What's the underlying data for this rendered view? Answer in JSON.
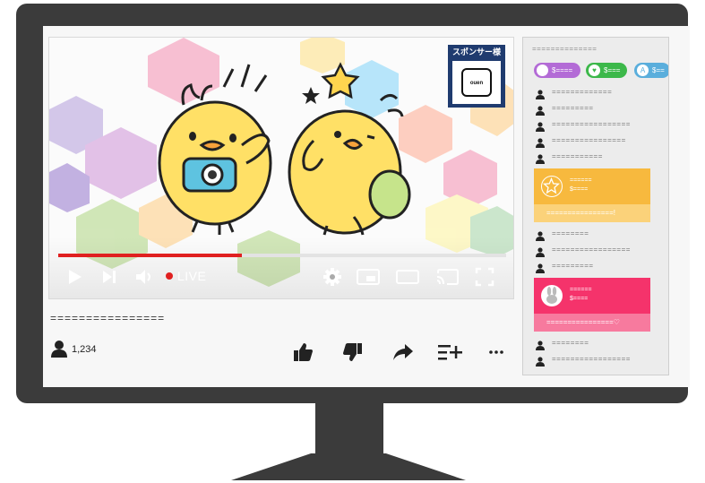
{
  "video": {
    "sponsor_label": "スポンサー様",
    "sponsor_logo": "ouen",
    "live_label": "LIVE",
    "progress": 0.41
  },
  "stream": {
    "title": "================",
    "viewer_count": "1,234"
  },
  "chat": {
    "header": "==============",
    "badges": [
      {
        "label": "$====",
        "color": "#b36bd6",
        "icon": "smile-icon"
      },
      {
        "label": "$===",
        "color": "#3cb84a",
        "icon": "heart-icon"
      },
      {
        "label": "$==",
        "color": "#5aaedc",
        "icon": "a-icon"
      }
    ],
    "messages_top": [
      "=============",
      "=========",
      "=================",
      "================",
      "==========="
    ],
    "superchat_1": {
      "name": "======",
      "amount": "$====",
      "text": "================!",
      "color_top": "#f7b93e",
      "color_bottom": "#fbd27a"
    },
    "messages_mid": [
      "========",
      "=================",
      "========="
    ],
    "superchat_2": {
      "name": "======",
      "amount": "$====",
      "text": "================♡",
      "color_top": "#f5336b",
      "color_bottom": "#f77a9e"
    },
    "messages_bottom": [
      "========",
      "================="
    ]
  }
}
